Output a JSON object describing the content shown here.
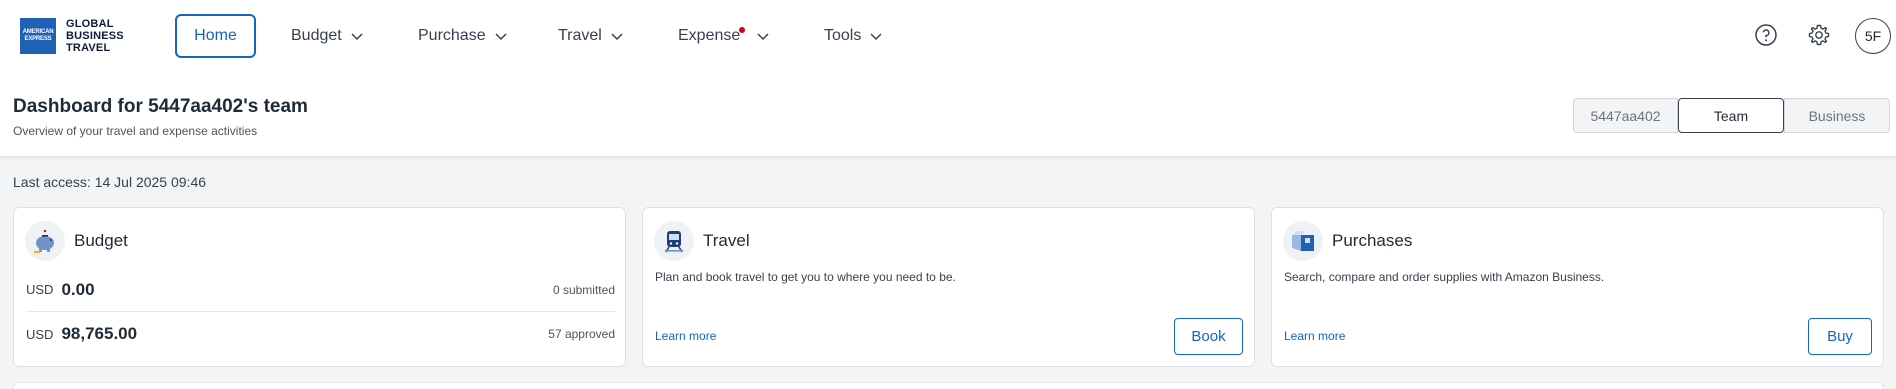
{
  "brand": {
    "mark_lines": [
      "AMERICAN",
      "EXPRESS"
    ],
    "text_lines": [
      "GLOBAL",
      "BUSINESS",
      "TRAVEL"
    ]
  },
  "nav": {
    "home": "Home",
    "budget": "Budget",
    "purchase": "Purchase",
    "travel": "Travel",
    "expense": "Expense",
    "tools": "Tools",
    "avatar_initials": "5F",
    "notification_color": "#d0021b",
    "accent_color": "#1565c0"
  },
  "header": {
    "title": "Dashboard for 5447aa402's team",
    "subtitle": "Overview of your travel and expense activities",
    "scope_options": [
      "5447aa402",
      "Team",
      "Business"
    ],
    "scope_selected": "Team"
  },
  "last_access": "Last access: 14 Jul 2025 09:46",
  "budget_card": {
    "title": "Budget",
    "rows": [
      {
        "currency": "USD",
        "amount": "0.00",
        "meta": "0 submitted"
      },
      {
        "currency": "USD",
        "amount": "98,765.00",
        "meta": "57 approved"
      }
    ]
  },
  "travel_card": {
    "title": "Travel",
    "description": "Plan and book travel to get you to where you need to be.",
    "learn_more": "Learn more",
    "action": "Book"
  },
  "purchases_card": {
    "title": "Purchases",
    "description": "Search, compare and order supplies with Amazon Business.",
    "learn_more": "Learn more",
    "action": "Buy"
  }
}
